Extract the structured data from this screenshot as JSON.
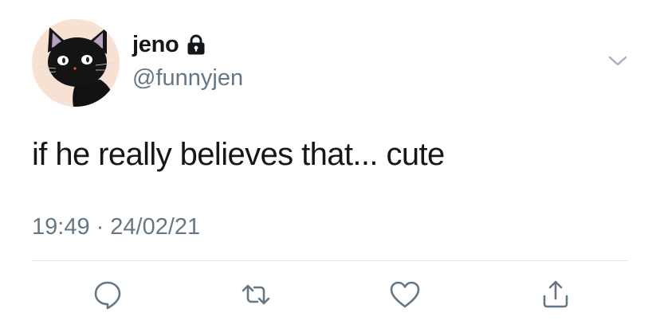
{
  "tweet": {
    "author": {
      "display_name": "jeno",
      "handle": "@funnyjen",
      "protected_icon": "lock-icon",
      "avatar_description": "black cat"
    },
    "menu_icon": "chevron-down-icon",
    "text": "if he really believes that... cute",
    "time": "19:49",
    "separator": "·",
    "date": "24/02/21",
    "actions": [
      {
        "name": "reply",
        "icon": "speech-bubble-icon"
      },
      {
        "name": "retweet",
        "icon": "retweet-icon"
      },
      {
        "name": "like",
        "icon": "heart-icon"
      },
      {
        "name": "share",
        "icon": "share-icon"
      }
    ]
  },
  "colors": {
    "primary_text": "#14171a",
    "secondary_text": "#657786",
    "avatar_background": "#f7e1d3",
    "divider": "#e1e8ed",
    "icon": "#657786"
  }
}
